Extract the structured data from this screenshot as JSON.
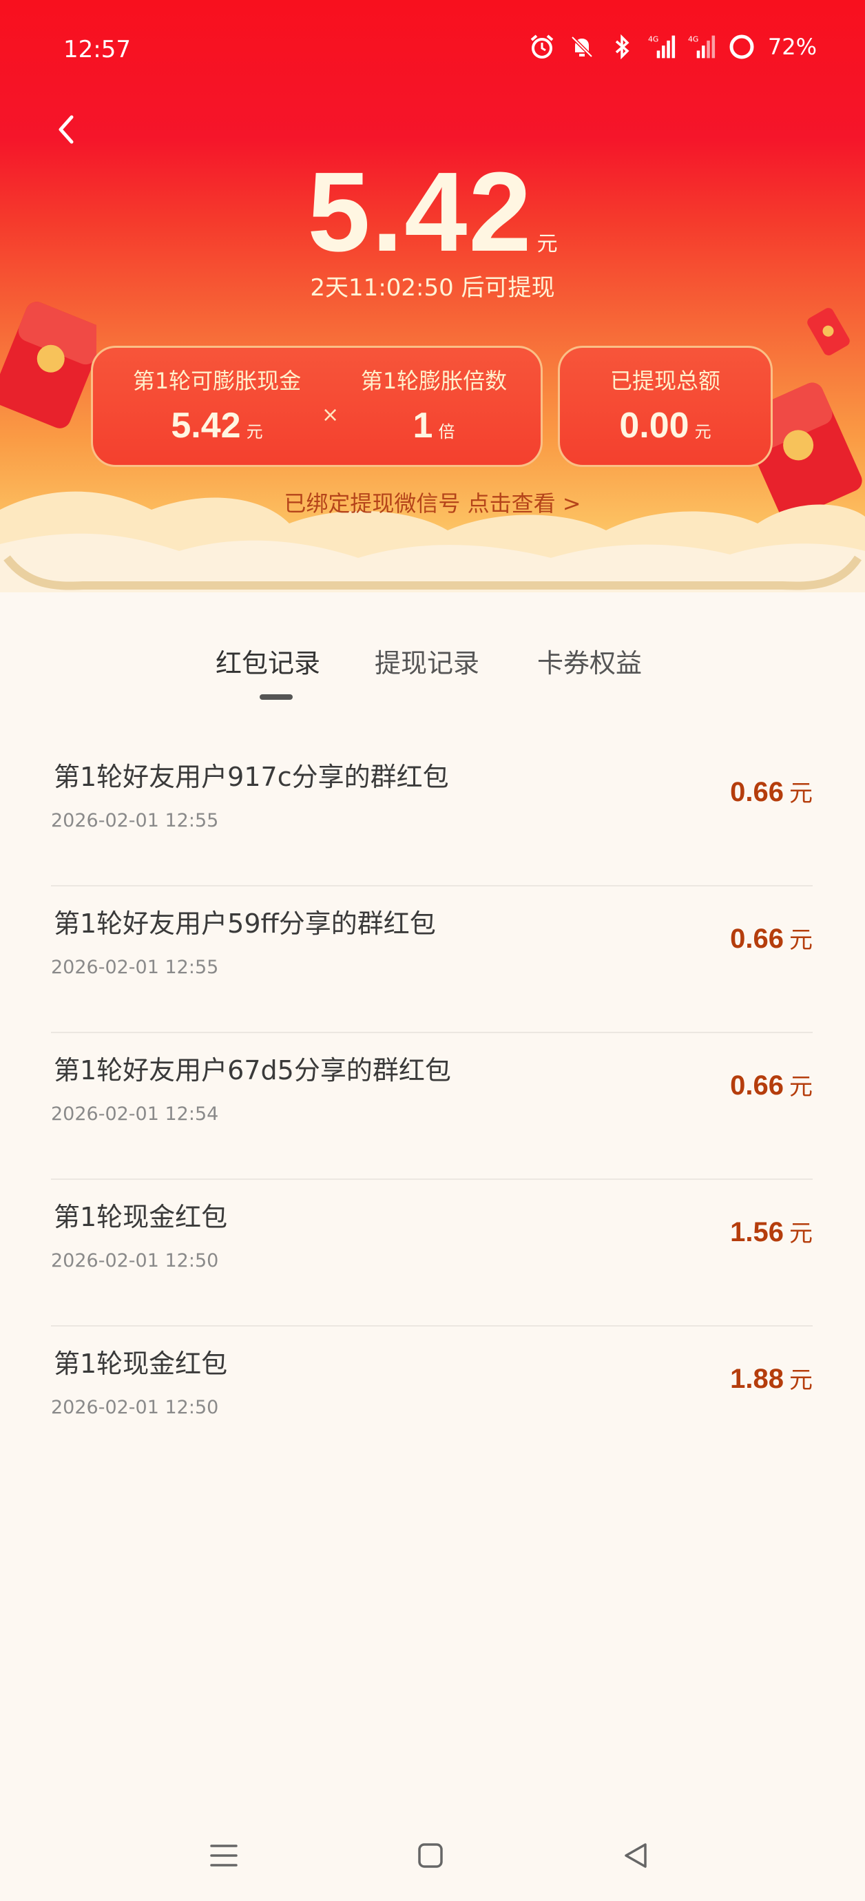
{
  "status_bar": {
    "time": "12:57",
    "battery": "72%",
    "icons": [
      "alarm-icon",
      "bell-off-icon",
      "bluetooth-icon",
      "signal-4g-icon",
      "signal-4g-icon",
      "battery-icon"
    ]
  },
  "header": {
    "back_icon": "chevron-left-icon",
    "amount": "5.42",
    "amount_unit": "元",
    "countdown": "2天11:02:50 后可提现"
  },
  "cards": {
    "inflate_cash_label": "第1轮可膨胀现金",
    "inflate_cash_value": "5.42",
    "inflate_cash_unit": "元",
    "times_sign": "×",
    "multiplier_label": "第1轮膨胀倍数",
    "multiplier_value": "1",
    "multiplier_unit": "倍",
    "withdrawn_label": "已提现总额",
    "withdrawn_value": "0.00",
    "withdrawn_unit": "元"
  },
  "bind_link": "已绑定提现微信号 点击查看 >",
  "tabs": [
    {
      "label": "红包记录"
    },
    {
      "label": "提现记录"
    },
    {
      "label": "卡券权益"
    }
  ],
  "active_tab": "红包记录",
  "records": [
    {
      "title": "第1轮好友用户917c分享的群红包",
      "time": "2026-02-01 12:55",
      "amount": "0.66",
      "unit": "元"
    },
    {
      "title": "第1轮好友用户59ff分享的群红包",
      "time": "2026-02-01 12:55",
      "amount": "0.66",
      "unit": "元"
    },
    {
      "title": "第1轮好友用户67d5分享的群红包",
      "time": "2026-02-01 12:54",
      "amount": "0.66",
      "unit": "元"
    },
    {
      "title": "第1轮现金红包",
      "time": "2026-02-01 12:50",
      "amount": "1.56",
      "unit": "元"
    },
    {
      "title": "第1轮现金红包",
      "time": "2026-02-01 12:50",
      "amount": "1.88",
      "unit": "元"
    }
  ],
  "nav_bar": {
    "icons": [
      "menu-icon",
      "home-icon",
      "back-triangle-icon"
    ]
  },
  "colors": {
    "hero_red": "#f8101e",
    "hero_orange": "#fa9c45",
    "amount_brown": "#b53d0c",
    "background": "#fdf8f2"
  }
}
